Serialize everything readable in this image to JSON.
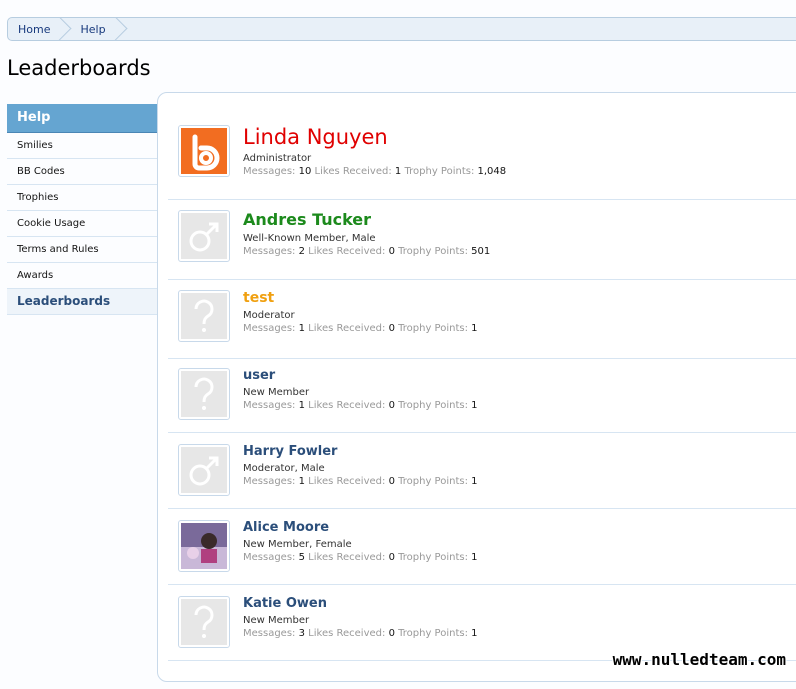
{
  "breadcrumb": [
    "Home",
    "Help"
  ],
  "page_title": "Leaderboards",
  "sidebar": {
    "heading": "Help",
    "items": [
      "Smilies",
      "BB Codes",
      "Trophies",
      "Cookie Usage",
      "Terms and Rules",
      "Awards",
      "Leaderboards"
    ],
    "active_index": 6
  },
  "labels": {
    "messages": "Messages:",
    "likes": "Likes Received:",
    "trophy": "Trophy Points:"
  },
  "members": [
    {
      "name": "Linda Nguyen",
      "title": "Administrator",
      "gender": "",
      "messages": "10",
      "likes": "1",
      "trophy": "1,048",
      "style": "admin",
      "avatar": "logo-b-icon"
    },
    {
      "name": "Andres Tucker",
      "title": "Well-Known Member",
      "gender": "Male",
      "messages": "2",
      "likes": "0",
      "trophy": "501",
      "style": "wellknown",
      "avatar": "male-icon"
    },
    {
      "name": "test",
      "title": "Moderator",
      "gender": "",
      "messages": "1",
      "likes": "0",
      "trophy": "1",
      "style": "moderator",
      "avatar": "question-icon"
    },
    {
      "name": "user",
      "title": "New Member",
      "gender": "",
      "messages": "1",
      "likes": "0",
      "trophy": "1",
      "style": "",
      "avatar": "question-icon"
    },
    {
      "name": "Harry Fowler",
      "title": "Moderator",
      "gender": "Male",
      "messages": "1",
      "likes": "0",
      "trophy": "1",
      "style": "",
      "avatar": "male-icon"
    },
    {
      "name": "Alice Moore",
      "title": "New Member",
      "gender": "Female",
      "messages": "5",
      "likes": "0",
      "trophy": "1",
      "style": "",
      "avatar": "photo-icon"
    },
    {
      "name": "Katie Owen",
      "title": "New Member",
      "gender": "",
      "messages": "3",
      "likes": "0",
      "trophy": "1",
      "style": "",
      "avatar": "question-icon"
    }
  ],
  "watermark": "www.nulledteam.com",
  "colors": {
    "admin": "#e00000",
    "wellknown": "#1c8a1c",
    "moderator": "#f0a010",
    "link": "#2b4e7a",
    "sidebar_head": "#65a5d1"
  }
}
